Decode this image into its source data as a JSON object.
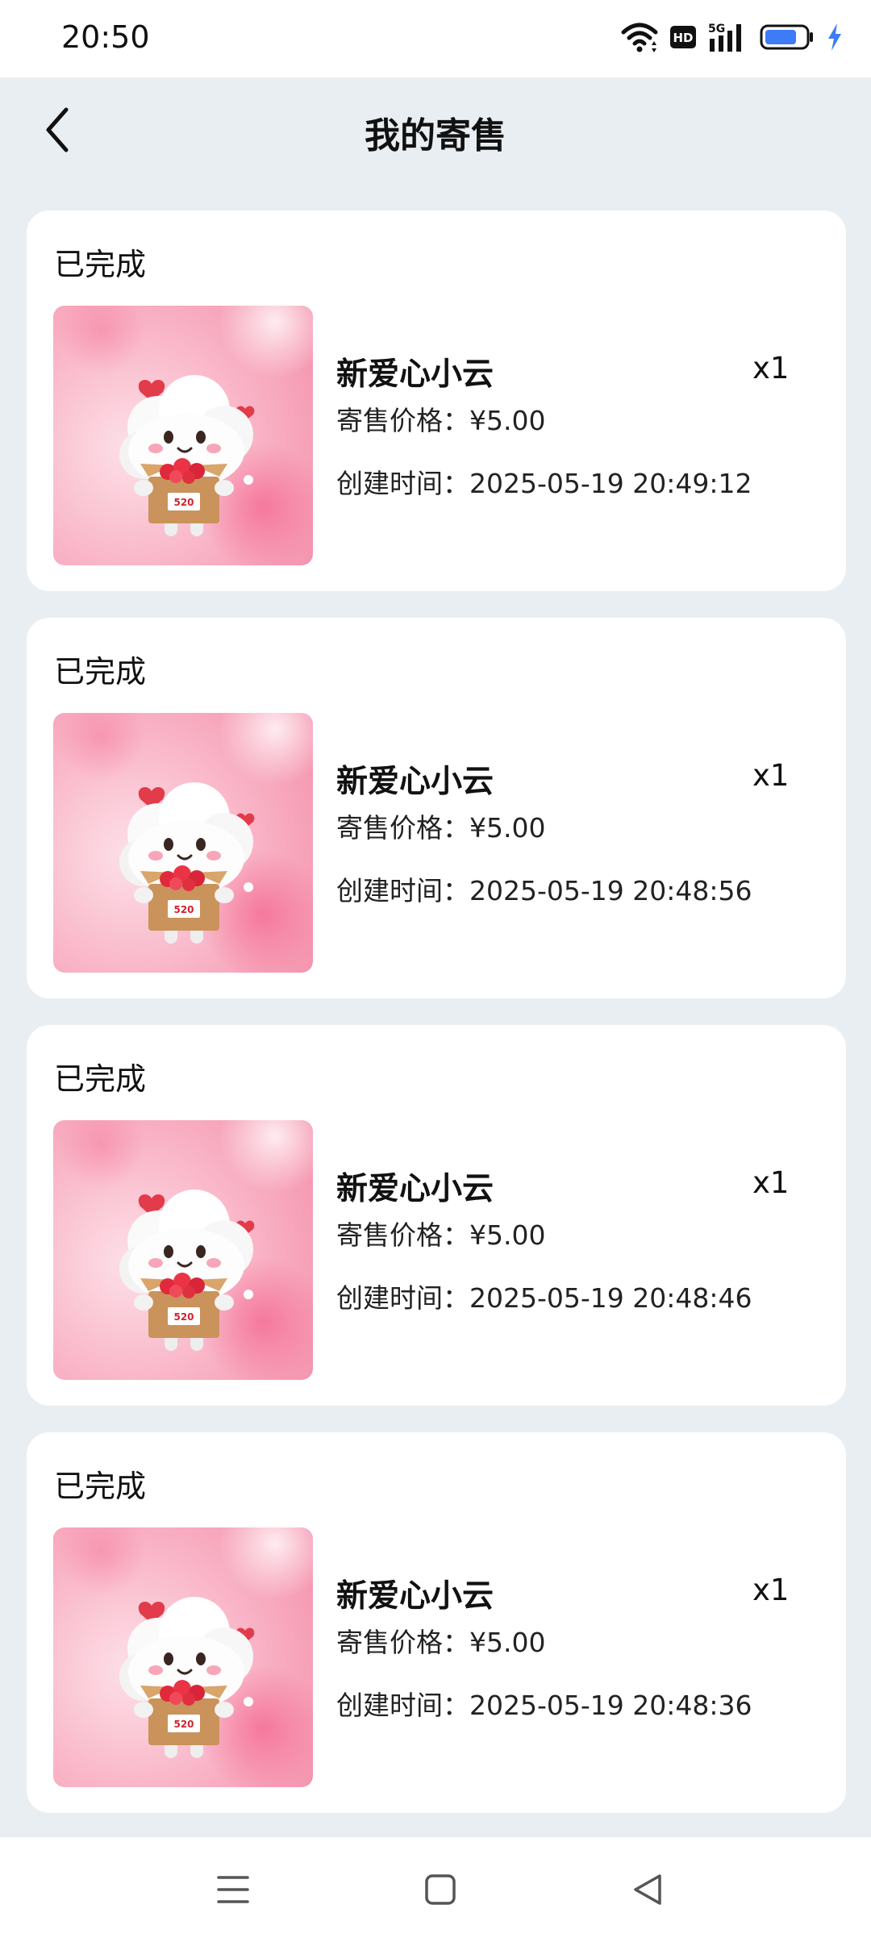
{
  "status_bar": {
    "time": "20:50",
    "icons": [
      "wifi-icon",
      "hd-icon",
      "signal-5g-icon",
      "battery-icon",
      "charging-icon"
    ],
    "hd_label": "HD",
    "network_label": "5G"
  },
  "header": {
    "title": "我的寄售",
    "back_icon": "chevron-left-icon"
  },
  "orders": [
    {
      "status": "已完成",
      "name": "新爱心小云",
      "quantity": "x1",
      "price": "寄售价格：¥5.00",
      "created": "创建时间：2025-05-19 20:49:12"
    },
    {
      "status": "已完成",
      "name": "新爱心小云",
      "quantity": "x1",
      "price": "寄售价格：¥5.00",
      "created": "创建时间：2025-05-19 20:48:56"
    },
    {
      "status": "已完成",
      "name": "新爱心小云",
      "quantity": "x1",
      "price": "寄售价格：¥5.00",
      "created": "创建时间：2025-05-19 20:48:46"
    },
    {
      "status": "已完成",
      "name": "新爱心小云",
      "quantity": "x1",
      "price": "寄售价格：¥5.00",
      "created": "创建时间：2025-05-19 20:48:36"
    }
  ],
  "thumbnail_box_label": "520",
  "bottom_nav": [
    "menu-icon",
    "home-icon",
    "back-triangle-icon"
  ],
  "colors": {
    "page_background": "#e8eef1",
    "card_background": "#ffffff",
    "thumbnail_pink": "#f9a9be",
    "battery_blue": "#3d7bf7"
  }
}
